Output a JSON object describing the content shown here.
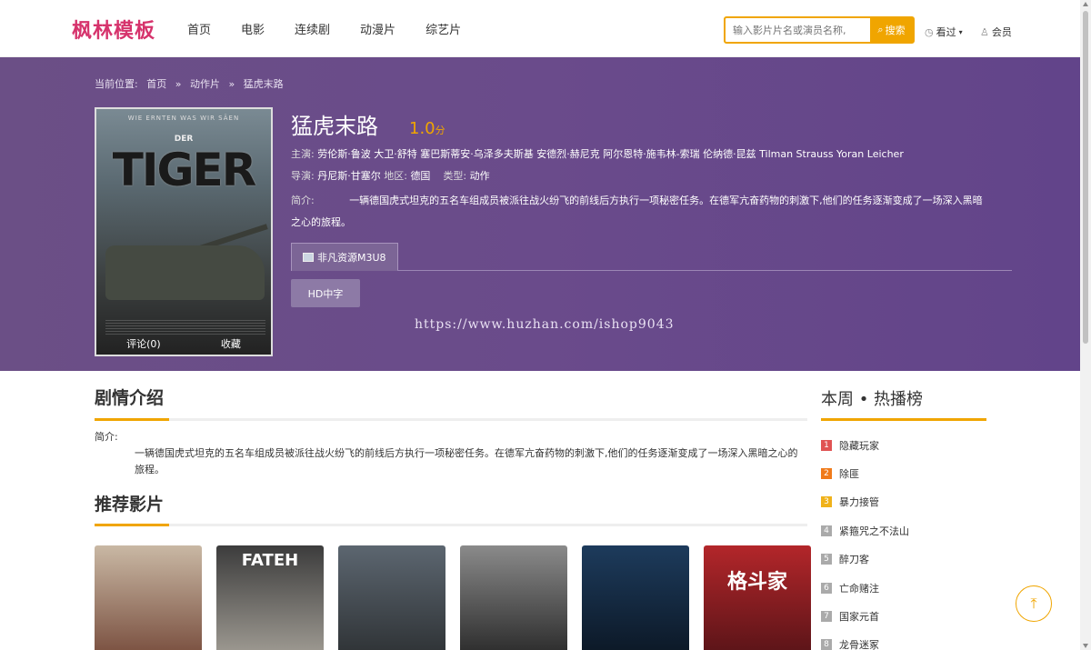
{
  "header": {
    "logo": "枫林模板",
    "nav": [
      "首页",
      "电影",
      "连续剧",
      "动漫片",
      "综艺片"
    ],
    "search_placeholder": "输入影片片名或演员名称,",
    "search_button": "搜索",
    "history": "看过",
    "member": "会员"
  },
  "breadcrumb": {
    "label": "当前位置:",
    "items": [
      "首页",
      "»",
      "动作片",
      "»",
      "猛虎末路"
    ]
  },
  "movie": {
    "title": "猛虎末路",
    "score": "1.0",
    "score_unit": "分",
    "cast_label": "主演:",
    "cast": "劳伦斯·鲁波 大卫·舒特 塞巴斯蒂安·乌泽多夫斯基 安德烈·赫尼克 阿尔恩特·施韦林-索瑞 伦纳德·昆兹 Tilman Strauss Yoran Leicher",
    "director_label": "导演:",
    "director": "丹尼斯·甘塞尔",
    "region_label": "地区:",
    "region": "德国",
    "type_label": "类型:",
    "type": "动作",
    "intro_label": "简介:",
    "intro": "一辆德国虎式坦克的五名车组成员被派往战火纷飞的前线后方执行一项秘密任务。在德军亢奋药物的刺激下,他们的任务逐渐变成了一场深入黑暗之心的旅程。",
    "poster": {
      "top_text": "WIE ERNTEN WAS WIR SÄEN",
      "der": "DER",
      "tiger": "TIGER",
      "comments": "评论(0)",
      "favorite": "收藏"
    }
  },
  "source": {
    "tab": "非凡资源M3U8",
    "episode": "HD中字"
  },
  "watermark": "https://www.huzhan.com/ishop9043",
  "plot_section": {
    "title": "剧情介绍",
    "label": "简介:",
    "text": "一辆德国虎式坦克的五名车组成员被派往战火纷飞的前线后方执行一项秘密任务。在德军亢奋药物的刺激下,他们的任务逐渐变成了一场深入黑暗之心的旅程。"
  },
  "recommend": {
    "title": "推荐影片",
    "items": [
      {
        "label": "",
        "colors": [
          "#c9b8a4",
          "#7a5040"
        ]
      },
      {
        "label": "FATEH",
        "colors": [
          "#3c3c3c",
          "#9e9a92"
        ]
      },
      {
        "label": "",
        "colors": [
          "#5c6670",
          "#2f3336"
        ]
      },
      {
        "label": "",
        "colors": [
          "#8a8a8a",
          "#2c2c2c"
        ]
      },
      {
        "label": "",
        "colors": [
          "#1d3b5c",
          "#0c1826"
        ]
      },
      {
        "label": "格斗家",
        "colors": [
          "#b3262a",
          "#5a1418"
        ]
      }
    ]
  },
  "sidebar": {
    "title": "本周 • 热播榜",
    "items": [
      {
        "num": "1",
        "name": "隐藏玩家",
        "color": "#e05353"
      },
      {
        "num": "2",
        "name": "除匪",
        "color": "#f07a1a"
      },
      {
        "num": "3",
        "name": "暴力接管",
        "color": "#f0b21a"
      },
      {
        "num": "4",
        "name": "紧箍咒之不法山",
        "color": "#aaaaaa"
      },
      {
        "num": "5",
        "name": "醉刀客",
        "color": "#aaaaaa"
      },
      {
        "num": "6",
        "name": "亡命赌注",
        "color": "#aaaaaa"
      },
      {
        "num": "7",
        "name": "国家元首",
        "color": "#aaaaaa"
      },
      {
        "num": "8",
        "name": "龙骨迷冢",
        "color": "#aaaaaa"
      }
    ]
  },
  "colors": {
    "accent": "#f0a500",
    "brand": "#d6336c",
    "hero": "#6a4b8b"
  }
}
